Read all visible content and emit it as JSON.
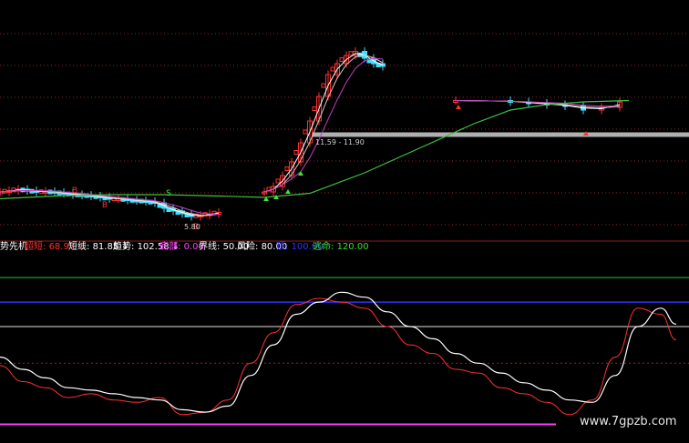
{
  "header_legend": {
    "title": "势先机",
    "items": [
      {
        "name": "超短",
        "value": "68.97",
        "arrow": "↓",
        "name_color": "#ff3030",
        "value_color": "#ff3030"
      },
      {
        "name": "短线",
        "value": "81.85",
        "arrow": "↓",
        "name_color": "#ffffff",
        "value_color": "#ffffff"
      },
      {
        "name": "趋势",
        "value": "102.58",
        "arrow": "↓",
        "name_color": "#ffffff",
        "value_color": "#ffffff"
      },
      {
        "name": "底部",
        "value": "0.00",
        "arrow": "",
        "name_color": "#ff40ff",
        "value_color": "#ff40ff"
      },
      {
        "name": "界线",
        "value": "50.00",
        "arrow": "",
        "name_color": "#ffffff",
        "value_color": "#ffffff"
      },
      {
        "name": "风险",
        "value": "80.00",
        "arrow": "",
        "name_color": "#ffffff",
        "value_color": "#ffffff"
      },
      {
        "name": "顶",
        "value": "100.00",
        "arrow": "",
        "name_color": "#3030ff",
        "value_color": "#3030ff"
      },
      {
        "name": "逃命",
        "value": "120.00",
        "arrow": "",
        "name_color": "#30e030",
        "value_color": "#30e030"
      }
    ]
  },
  "price_annotations": {
    "high_range": "11.59 - 11.90",
    "low_value": "5.80",
    "buy_marker": "B",
    "sell_marker": "S"
  },
  "watermark": "www.7gpzb.com",
  "colors": {
    "background": "#000000",
    "up_candle": "#ff3030",
    "down_candle": "#40e0ff",
    "ma_white": "#ffffff",
    "ma_magenta": "#c040c0",
    "ma_green": "#40c040",
    "guide_dotted": "#a02020",
    "baseline_gray": "#b0b0b0"
  },
  "chart_data": [
    {
      "type": "candlestick",
      "title": "",
      "note": "price panel with overlaid moving averages; no axes printed",
      "segments": [
        {
          "x": [
            0,
            10,
            20,
            30,
            40,
            50,
            60,
            70,
            80,
            90,
            100,
            110,
            120,
            130,
            140,
            150,
            160,
            170,
            180,
            190,
            200,
            210,
            220,
            230,
            240
          ],
          "close": [
            6.7,
            6.75,
            6.8,
            6.75,
            6.7,
            6.72,
            6.68,
            6.65,
            6.6,
            6.58,
            6.55,
            6.5,
            6.45,
            6.45,
            6.4,
            6.38,
            6.35,
            6.3,
            6.1,
            6.0,
            5.9,
            5.8,
            5.85,
            5.9,
            5.95
          ]
        },
        {
          "x": [
            290,
            300,
            310,
            320,
            330,
            340,
            350,
            360,
            370,
            380,
            390,
            400,
            410,
            420
          ],
          "close": [
            6.7,
            6.9,
            7.3,
            7.8,
            8.5,
            9.3,
            10.2,
            11.0,
            11.4,
            11.7,
            11.85,
            11.6,
            11.4,
            11.3
          ]
        },
        {
          "x": [
            500,
            560,
            580,
            600,
            620,
            640,
            660,
            680
          ],
          "close": [
            10.05,
            10.0,
            9.95,
            9.9,
            9.85,
            9.7,
            9.8,
            10.0
          ]
        }
      ]
    },
    {
      "type": "line",
      "title": "",
      "note": "oscillator panel with reference levels",
      "reference_levels": {
        "底部": 0,
        "界线": 50,
        "风险": 80,
        "顶": 100,
        "逃命": 120
      },
      "ylim": [
        -10,
        135
      ],
      "x": [
        0,
        25,
        50,
        75,
        100,
        125,
        150,
        175,
        200,
        225,
        250,
        275,
        300,
        325,
        350,
        375,
        400,
        425,
        450,
        475,
        500,
        525,
        550,
        575,
        600,
        625,
        650,
        675,
        700,
        725,
        742
      ],
      "series": [
        {
          "name": "超短",
          "values": [
            48,
            35,
            30,
            22,
            25,
            20,
            18,
            22,
            8,
            10,
            20,
            50,
            75,
            98,
            103,
            100,
            95,
            80,
            65,
            58,
            45,
            42,
            30,
            25,
            18,
            8,
            20,
            55,
            95,
            90,
            69
          ]
        },
        {
          "name": "短线",
          "values": [
            55,
            45,
            38,
            30,
            28,
            25,
            22,
            20,
            12,
            10,
            15,
            40,
            65,
            90,
            100,
            108,
            104,
            92,
            80,
            70,
            58,
            50,
            42,
            34,
            28,
            20,
            18,
            40,
            80,
            95,
            82
          ]
        }
      ]
    }
  ]
}
